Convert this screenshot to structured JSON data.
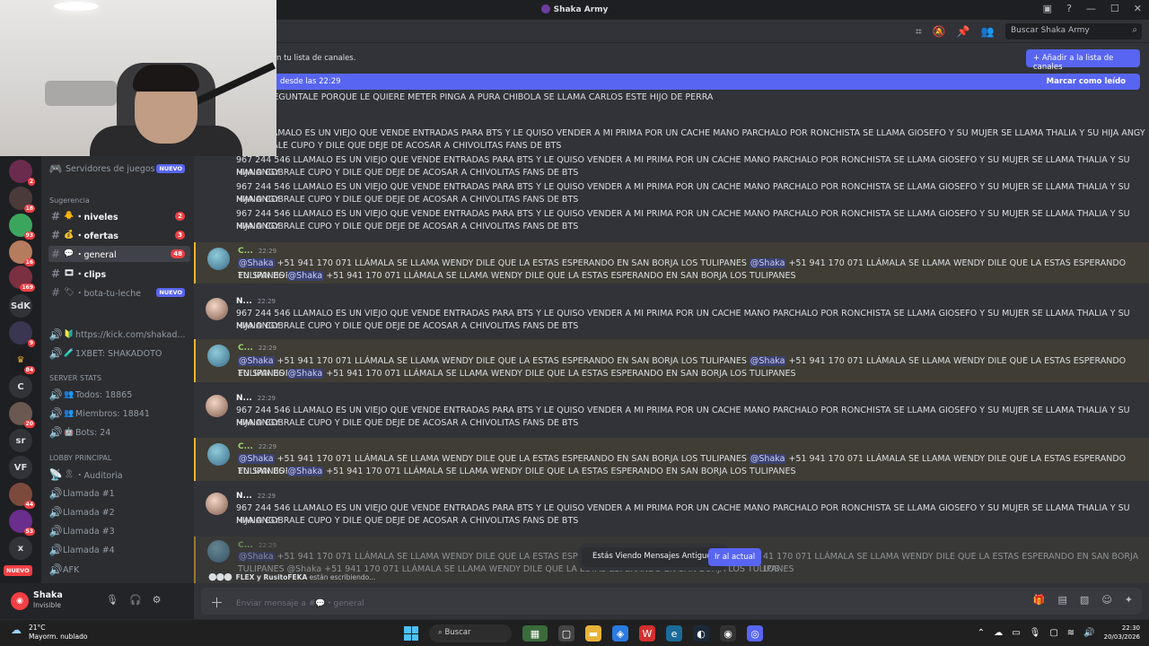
{
  "window": {
    "title": "Shaka Army",
    "search_placeholder": "Buscar Shaka Army"
  },
  "guild_badges": [
    "2",
    "18",
    "93",
    "16",
    "169",
    "9",
    "84",
    "20",
    "44",
    "53"
  ],
  "guild_labels": {
    "sdk": "SdK",
    "c": "C",
    "sr": "sr",
    "vf": "VF",
    "x": "x",
    "nuevo": "NUEVO"
  },
  "channels": {
    "servidores": "Servidores de juegos",
    "servidores_badge": "NUEVO",
    "category_sugerencia": "Sugerencia",
    "niveles": "・niveles",
    "niveles_count": "2",
    "ofertas": "・ofertas",
    "ofertas_count": "3",
    "general": "・general",
    "general_count": "48",
    "clips": "・clips",
    "bota": "・bota-tu-leche",
    "bota_badge": "NUEVO",
    "kick": "https://kick.com/shakad...",
    "xbet": "1XBET: SHAKADOTO",
    "category_stats": "SERVER STATS",
    "todos": "Todos: 18865",
    "miembros": "Miembros: 18841",
    "bots": "Bots: 24",
    "category_lobby": "LOBBY PRINCIPAL",
    "auditoria": "・Auditoria",
    "llamada1": "Llamada #1",
    "llamada2": "Llamada #2",
    "llamada3": "Llamada #3",
    "llamada4": "Llamada #4",
    "afk": "AFK"
  },
  "user": {
    "name": "Shaka",
    "status": "Invisible"
  },
  "banner": {
    "notice": "n tu lista de canales.",
    "add_button": "+ Añadir a la lista de canales",
    "new_since": "desde las 22:29",
    "mark_read": "Marcar como leído"
  },
  "messages": {
    "m0": "2 PREGUNTALE PORQUE LE QUIERE METER PINGA A PURA CHIBOLA SE LLAMA CARLOS ESTE HIJO DE PERRA",
    "m1a": "6 LLAMALO ES UN VIEJO QUE VENDE ENTRADAS PARA BTS Y LE QUISO VENDER A MI PRIMA POR UN CACHE MANO PARCHALO POR RONCHISTA SE LLAMA GIOSEFO Y SU MUJER SE LLAMA THALIA Y SU HIJA ANGY",
    "m1b": "OBRALE CUPO Y DILE QUE DEJE DE ACOSAR A CHIVOLITAS FANS DE BTS",
    "long": "967 244 546 LLAMALO ES UN VIEJO QUE VENDE ENTRADAS PARA BTS Y LE QUISO VENDER A MI PRIMA POR UN CACHE MANO PARCHALO POR RONCHISTA SE LLAMA GIOSEFO Y SU MUJER SE LLAMA THALIA Y SU HIJA ANGY",
    "long2": "MANO COBRALE CUPO Y DILE QUE DEJE DE ACOSAR A CHIVOLITAS FANS DE BTS",
    "mention": "@Shaka",
    "wendy": " +51 941 170 071 LLÁMALA SE LLAMA WENDY DILE QUE LA ESTAS ESPERANDO EN SAN BORJA LOS TULIPANES ",
    "wendy_a": " +51 941 170 071 LLÁMALA SE LLAMA WENDY DILE QUE LA ESTAS ESPERANDO EN SAN BORJA LOS",
    "wendy_b": "TULIPANES ",
    "author_c": "C...",
    "author_n": "N...",
    "time": "22:29",
    "partial": " +51 941 170 071 LLÁMALA SE LLAMA WENDY DILE QUE LA ESTAS ESPERANDO E",
    "partial_end": "41 170 071 LLÁMALA SE LLAMA WENDY DILE QUE LA ESTAS ESPERANDO EN SAN BORJA LOS",
    "partial2": "TULIPANES  @Shaka  +51 941 170 071 LLÁMALA SE LLAMA WENDY DILE QUE LA ESTAS ESPERANDO EN SAN BORJA LOS TULIPANES"
  },
  "old_messages": {
    "label": "Estás Viendo Mensajes Antiguos",
    "button": "Ir al actual"
  },
  "typing": {
    "names": "FLEX y RusitoFEKA",
    "suffix": " están escribiendo..."
  },
  "composer": {
    "placeholder": "Enviar mensaje a #💬・general"
  },
  "taskbar": {
    "temp": "21°C",
    "weather": "Mayorm. nublado",
    "search": "Buscar",
    "time": "22:30",
    "date": "20/03/2026"
  }
}
